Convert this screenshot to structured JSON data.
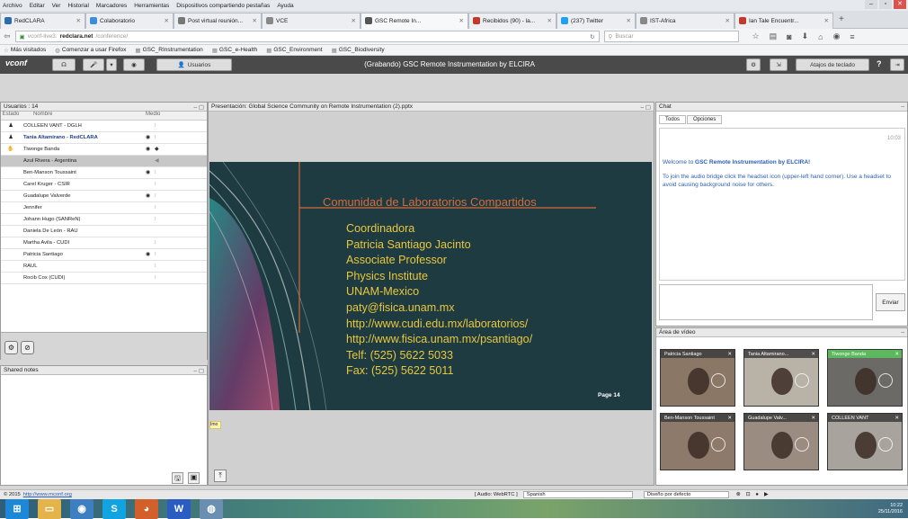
{
  "menu": [
    "Archivo",
    "Editar",
    "Ver",
    "Historial",
    "Marcadores",
    "Herramientas",
    "Dispositivos compartiendo pestañas",
    "Ayuda"
  ],
  "tabs": [
    {
      "label": "RedCLARA",
      "color": "#2b6cb0",
      "active": false
    },
    {
      "label": "Colaboratorio",
      "color": "#3a8fd6",
      "active": false
    },
    {
      "label": "Post virtual reunión...",
      "color": "#777",
      "active": false
    },
    {
      "label": "VCE",
      "color": "#888",
      "active": false
    },
    {
      "label": "GSC Remote In...",
      "color": "#555",
      "active": true
    },
    {
      "label": "Recibidos (90) - la...",
      "color": "#c0392b",
      "active": false
    },
    {
      "label": "(237) Twitter",
      "color": "#1da1f2",
      "active": false
    },
    {
      "label": "IST-Africa",
      "color": "#888",
      "active": false
    },
    {
      "label": "Ian Tale Encuentr...",
      "color": "#c0392b",
      "active": false
    }
  ],
  "nav": {
    "url_gray": "vconf-live3.",
    "url_domain": "redclara.net",
    "url_path": "/conference/",
    "search_placeholder": "Buscar"
  },
  "bookmarks": [
    "Más visitados",
    "Comenzar a usar Firefox",
    "GSC_RInstrumentation",
    "GSC_e-Health",
    "GSC_Environment",
    "GSC_Biodiversity"
  ],
  "appbar": {
    "logo": "vconf",
    "users_button": "Usuarios",
    "title": "(Grabando) GSC  Remote Instrumentation by ELCIRA",
    "shortcuts_button": "Atajos de teclado",
    "help": "?"
  },
  "users": {
    "title": "Usuarios : 14",
    "headers": [
      "Estado",
      "Nombre",
      "Medio"
    ],
    "rows": [
      {
        "name": "COLLEEN VANT - DGLH",
        "status": "person",
        "cam": false,
        "mic": "mic",
        "selected": false
      },
      {
        "name": "Tania Altamirano - RedCLARA",
        "status": "person",
        "cam": true,
        "mic": "mic",
        "selected": false,
        "bold": true
      },
      {
        "name": "Tiwonge Banda",
        "status": "hand",
        "cam": true,
        "mic": "mic-dark",
        "selected": false
      },
      {
        "name": "Azul Rivera - Argentina",
        "status": "",
        "cam": false,
        "mic": "speaker",
        "selected": true
      },
      {
        "name": "Ben-Manson Toussaint",
        "status": "",
        "cam": true,
        "mic": "mic",
        "selected": false
      },
      {
        "name": "Carel Kruger - CSIR",
        "status": "",
        "cam": false,
        "mic": "mic",
        "selected": false
      },
      {
        "name": "Guadalupe Valverde",
        "status": "",
        "cam": true,
        "mic": "mic",
        "selected": false
      },
      {
        "name": "Jennifer",
        "status": "",
        "cam": false,
        "mic": "mic",
        "selected": false
      },
      {
        "name": "Johann Hugo (SANReN)",
        "status": "",
        "cam": false,
        "mic": "mic",
        "selected": false
      },
      {
        "name": "Daniela De León - RAU",
        "status": "",
        "cam": false,
        "mic": "",
        "selected": false
      },
      {
        "name": "Martha Avila - CUDI",
        "status": "",
        "cam": false,
        "mic": "mic",
        "selected": false
      },
      {
        "name": "Patricia Santiago",
        "status": "",
        "cam": true,
        "mic": "mic",
        "selected": false
      },
      {
        "name": "RAUL",
        "status": "",
        "cam": false,
        "mic": "mic",
        "selected": false
      },
      {
        "name": "Rocib Cox (CUDI)",
        "status": "",
        "cam": false,
        "mic": "mic",
        "selected": false
      }
    ]
  },
  "shared_notes": {
    "title": "Shared notes"
  },
  "presentation": {
    "title": "Presentación: Global Science Community on Remote Instrumentation (2).pptx",
    "slide_title": "Comunidad de Laboratorios Compartidos",
    "lines": [
      "Coordinadora",
      "Patricia Santiago Jacinto",
      "Associate Professor",
      "Physics Institute",
      "UNAM-Mexico",
      "paty@fisica.unam.mx",
      "http://www.cudi.edu.mx/laboratorios/",
      "http://www.fisica.unam.mx/psantiago/",
      "Telf: (525) 5622 5033",
      "Fax: (525) 5622 5011"
    ],
    "page": "Page 14",
    "thumb": "Imo"
  },
  "chat": {
    "title": "Chat",
    "tabs": [
      "Todos",
      "Opciones"
    ],
    "time": "10:03",
    "welcome_prefix": "Welcome to ",
    "welcome_bold": "GSC  Remote Instrumentation by ELCIRA!",
    "instructions": "To join the audio bridge click the headset icon (upper-left hand corner).  Use a headset to avoid causing background noise for others.",
    "send": "Enviar"
  },
  "video": {
    "title": "Área de vídeo",
    "tiles": [
      {
        "name": "Patricia Santiago",
        "green": false,
        "color": "#8a7766"
      },
      {
        "name": "Tania Altamirano...",
        "green": false,
        "color": "#b9b2a6"
      },
      {
        "name": "Tiwonge Banda",
        "green": true,
        "color": "#6b6a66"
      },
      {
        "name": "Ben-Manson Toussaint",
        "green": false,
        "color": "#8d7a6a"
      },
      {
        "name": "Guadalupe Valv...",
        "green": false,
        "color": "#9a8c80"
      },
      {
        "name": "COLLEEN VANT",
        "green": false,
        "color": "#a8a39d"
      }
    ]
  },
  "statusbar": {
    "copyright": "© 2015",
    "link": "http://www.mconf.org",
    "audio": "[ Audio: WebRTC ]",
    "lang": "Spanish",
    "layout": "Diseño por defecto"
  },
  "taskbar": {
    "time": "10:22",
    "date": "25/11/2016"
  }
}
